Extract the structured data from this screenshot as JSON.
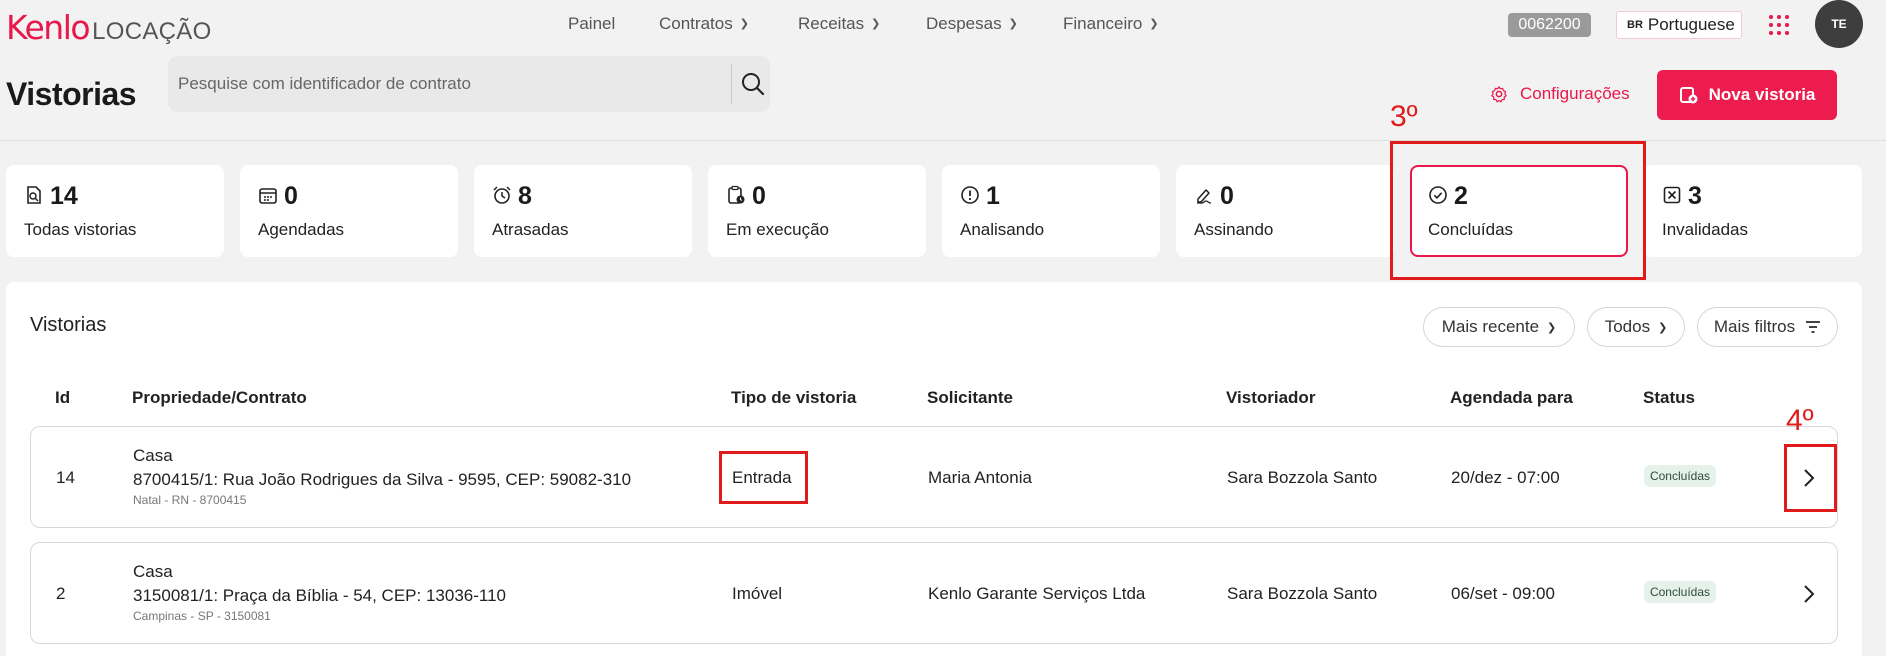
{
  "brand": {
    "logo_main": "Kenlo",
    "logo_sub": "LOCAÇÃO"
  },
  "nav": {
    "items": [
      {
        "label": "Painel",
        "dropdown": false
      },
      {
        "label": "Contratos",
        "dropdown": true
      },
      {
        "label": "Receitas",
        "dropdown": true
      },
      {
        "label": "Despesas",
        "dropdown": true
      },
      {
        "label": "Financeiro",
        "dropdown": true
      }
    ],
    "code": "0062200",
    "language_flag": "BR",
    "language": "Portuguese",
    "avatar_initials": "TE"
  },
  "header": {
    "title": "Vistorias",
    "search_placeholder": "Pesquise com identificador de contrato",
    "config_label": "Configurações",
    "new_button_label": "Nova vistoria"
  },
  "stats": [
    {
      "icon": "search-doc-icon",
      "value": "14",
      "label": "Todas vistorias"
    },
    {
      "icon": "calendar-icon",
      "value": "0",
      "label": "Agendadas"
    },
    {
      "icon": "alarm-clock-icon",
      "value": "8",
      "label": "Atrasadas"
    },
    {
      "icon": "clipboard-clock-icon",
      "value": "0",
      "label": "Em execução"
    },
    {
      "icon": "alert-circle-icon",
      "value": "1",
      "label": "Analisando"
    },
    {
      "icon": "pen-sign-icon",
      "value": "0",
      "label": "Assinando"
    },
    {
      "icon": "check-circle-icon",
      "value": "2",
      "label": "Concluídas",
      "selected": true
    },
    {
      "icon": "x-square-icon",
      "value": "3",
      "label": "Invalidadas"
    }
  ],
  "annotations": {
    "step3": "3º",
    "step4": "4º"
  },
  "list": {
    "title": "Vistorias",
    "sort_label": "Mais recente",
    "filter_label": "Todos",
    "more_filters_label": "Mais filtros",
    "columns": [
      "Id",
      "Propriedade/Contrato",
      "Tipo de vistoria",
      "Solicitante",
      "Vistoriador",
      "Agendada para",
      "Status"
    ],
    "rows": [
      {
        "id": "14",
        "property_type": "Casa",
        "contract": "8700415/1: Rua João Rodrigues da Silva - 9595, CEP: 59082-310",
        "location": "Natal - RN - 8700415",
        "type": "Entrada",
        "requester": "Maria Antonia",
        "inspector": "Sara Bozzola Santo",
        "scheduled": "20/dez - 07:00",
        "status": "Concluídas"
      },
      {
        "id": "2",
        "property_type": "Casa",
        "contract": "3150081/1: Praça da Bíblia - 54, CEP: 13036-110",
        "location": "Campinas - SP - 3150081",
        "type": "Imóvel",
        "requester": "Kenlo Garante Serviços Ltda",
        "inspector": "Sara Bozzola Santo",
        "scheduled": "06/set - 09:00",
        "status": "Concluídas"
      }
    ]
  },
  "colors": {
    "accent": "#e8184a",
    "annotation": "#e01b1b",
    "status_bg": "#e4f2ea"
  }
}
